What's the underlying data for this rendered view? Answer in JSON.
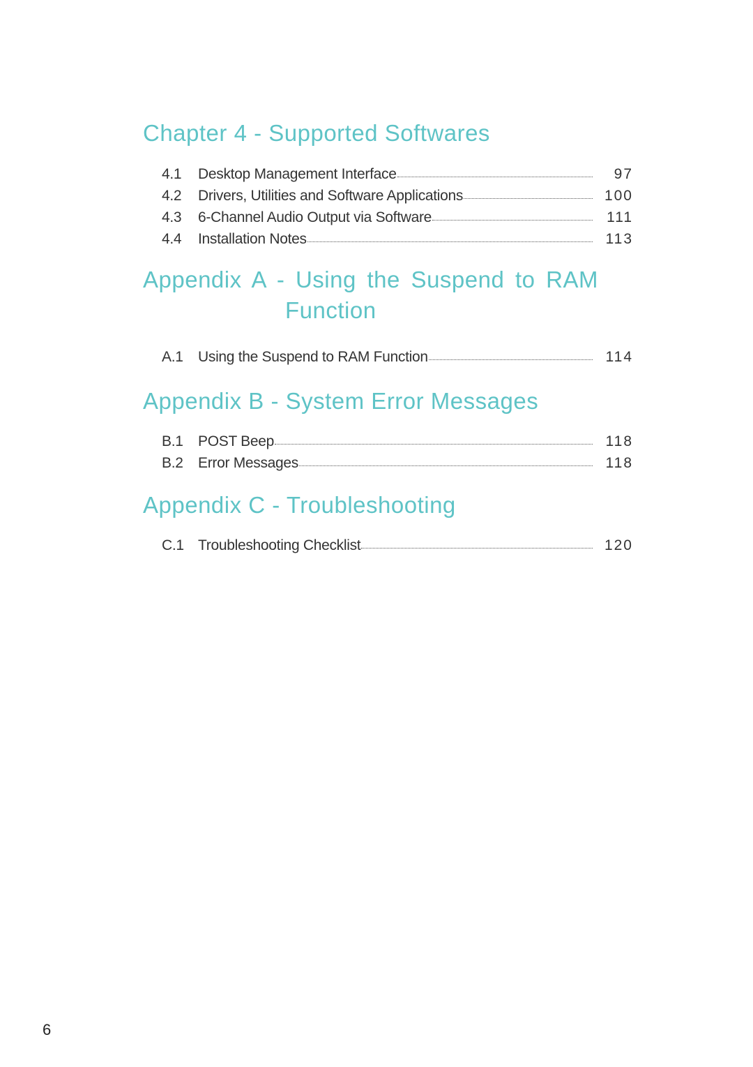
{
  "sections": [
    {
      "heading": "Chapter 4 - Supported Softwares",
      "entries": [
        {
          "num": "4.1",
          "title": "Desktop Management Interface",
          "page": "97"
        },
        {
          "num": "4.2",
          "title": "Drivers, Utilities and Software Applications",
          "page": "100"
        },
        {
          "num": "4.3",
          "title": "6-Channel Audio Output via Software",
          "page": "111"
        },
        {
          "num": "4.4",
          "title": "Installation Notes",
          "page": "113"
        }
      ]
    },
    {
      "heading_line1": "Appendix A - Using the Suspend to RAM",
      "heading_line2": "Function",
      "entries": [
        {
          "num": "A.1",
          "title": "Using the Suspend to RAM Function",
          "page": "114"
        }
      ]
    },
    {
      "heading": "Appendix B - System Error Messages",
      "entries": [
        {
          "num": "B.1",
          "title": "POST Beep",
          "page": "118"
        },
        {
          "num": "B.2",
          "title": "Error Messages",
          "page": "118"
        }
      ]
    },
    {
      "heading": "Appendix C - Troubleshooting",
      "entries": [
        {
          "num": "C.1",
          "title": "Troubleshooting Checklist",
          "page": "120"
        }
      ]
    }
  ],
  "footer": {
    "page_number": "6"
  },
  "colors": {
    "heading": "#5ec3c6",
    "text": "#333333"
  }
}
